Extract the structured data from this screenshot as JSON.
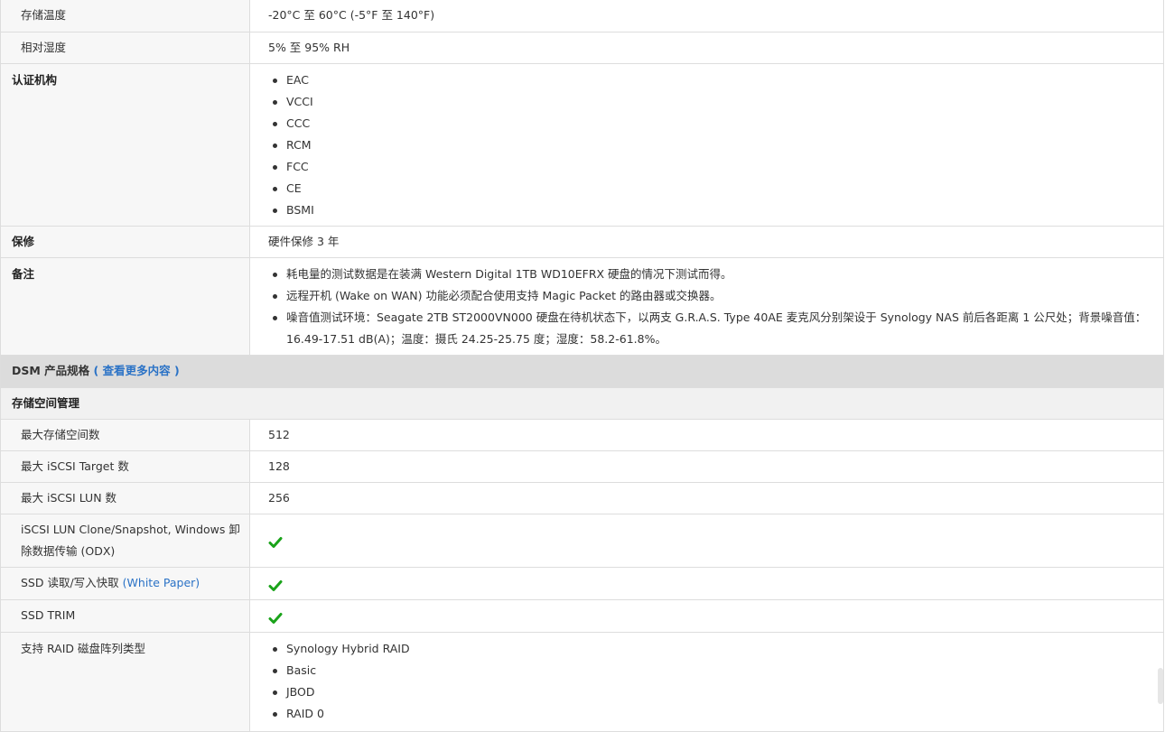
{
  "rows_top": [
    {
      "label": "存储温度",
      "value": "-20°C 至 60°C (-5°F 至 140°F)"
    },
    {
      "label": "相对湿度",
      "value": "5% 至 95% RH"
    }
  ],
  "certification": {
    "label": "认证机构",
    "items": [
      "EAC",
      "VCCI",
      "CCC",
      "RCM",
      "FCC",
      "CE",
      "BSMI"
    ]
  },
  "warranty": {
    "label": "保修",
    "value": "硬件保修 3 年"
  },
  "notes": {
    "label": "备注",
    "items": [
      "耗电量的测试数据是在装满 Western Digital 1TB WD10EFRX 硬盘的情况下测试而得。",
      "远程开机 (Wake on WAN) 功能必须配合使用支持 Magic Packet 的路由器或交换器。",
      "噪音值测试环境：Seagate 2TB ST2000VN000 硬盘在待机状态下，以两支 G.R.A.S. Type 40AE 麦克风分别架设于 Synology NAS 前后各距离 1 公尺处；背景噪音值：16.49-17.51 dB(A)；温度：摄氏 24.25-25.75 度；湿度：58.2-61.8%。"
    ]
  },
  "dsm_section": {
    "title": "DSM 产品规格",
    "link": "( 查看更多内容 )"
  },
  "storage_mgmt": {
    "title": "存储空间管理",
    "rows": [
      {
        "label": "最大存储空间数",
        "value": "512"
      },
      {
        "label": "最大 iSCSI Target 数",
        "value": "128"
      },
      {
        "label": "最大 iSCSI LUN 数",
        "value": "256"
      }
    ],
    "odx_label": "iSCSI LUN Clone/Snapshot, Windows 卸除数据传输 (ODX)",
    "ssd_cache_label": "SSD 读取/写入快取",
    "ssd_cache_link": "(White Paper)",
    "ssd_trim_label": "SSD TRIM",
    "raid_label": "支持 RAID 磁盘阵列类型",
    "raid_items": [
      "Synology Hybrid RAID",
      "Basic",
      "JBOD",
      "RAID 0"
    ]
  },
  "colors": {
    "check": "#1aa31a",
    "link": "#2a72c6",
    "section_bg": "#dcdcdc"
  }
}
